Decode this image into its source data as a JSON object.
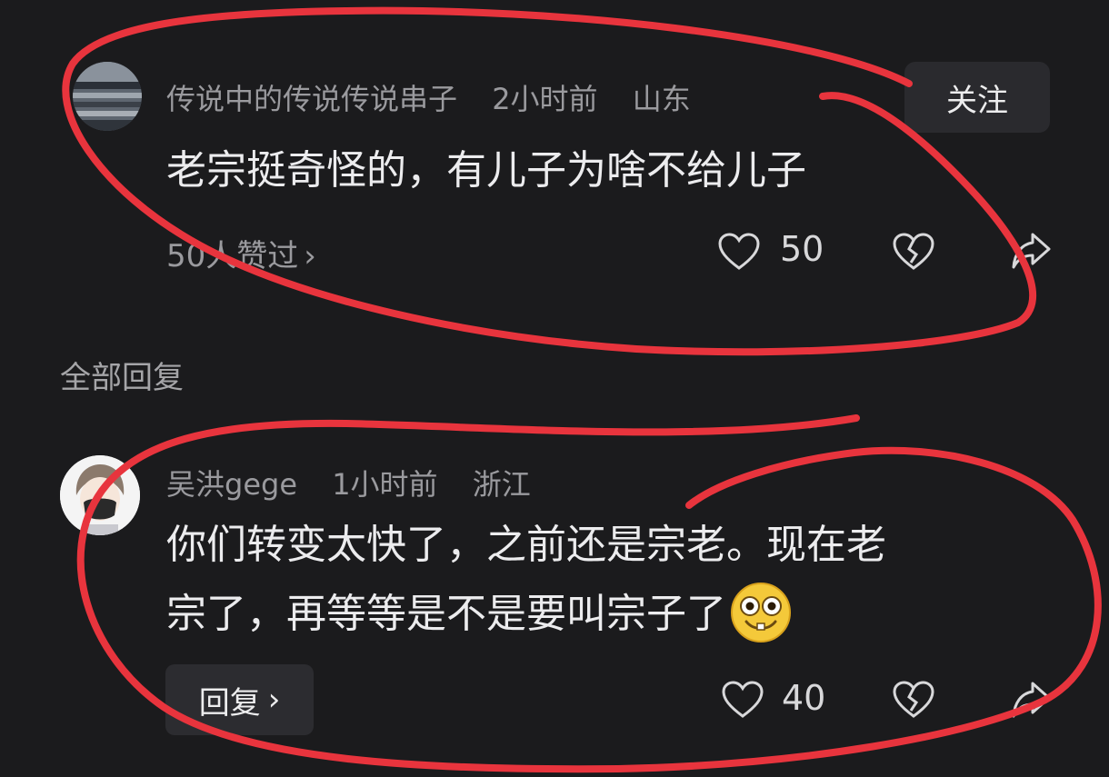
{
  "comment": {
    "username": "传说中的传说传说串子",
    "time": "2小时前",
    "location": "山东",
    "follow_label": "关注",
    "text": "老宗挺奇怪的，有儿子为啥不给儿子",
    "likers_text": "50人赞过",
    "likers_chevron": "›",
    "like_count": "50",
    "icons": [
      "heart-icon",
      "broken-heart-icon",
      "share-arrow-icon"
    ]
  },
  "section_title": "全部回复",
  "reply": {
    "username": "吴洪gege",
    "time": "1小时前",
    "location": "浙江",
    "text_line1": "你们转变太快了，之前还是宗老。现在老",
    "text_line2": "宗了，再等等是不是要叫宗子了",
    "emoji": "grinning-face-emoji",
    "reply_label": "回复",
    "reply_chevron": "›",
    "like_count": "40"
  },
  "colors": {
    "background": "#1b1b1d",
    "annotation_red": "#e8343d",
    "muted_text": "#9a9a9e",
    "button_bg": "#2a2a2e"
  }
}
